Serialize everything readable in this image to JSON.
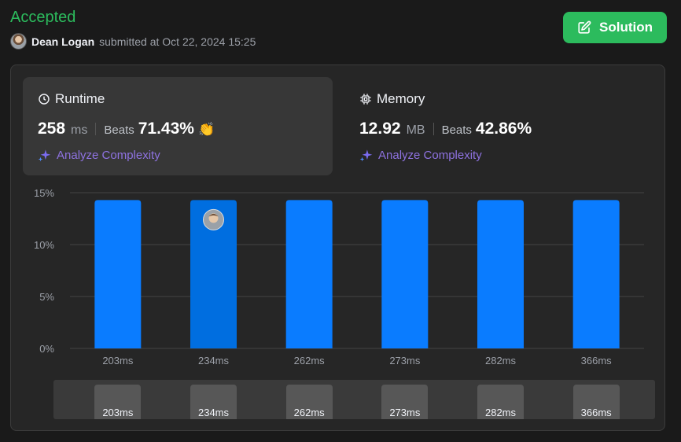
{
  "header": {
    "status": "Accepted",
    "user_name": "Dean Logan",
    "submitted_text": "submitted at Oct 22, 2024 15:25",
    "solution_label": "Solution"
  },
  "runtime": {
    "title": "Runtime",
    "value": "258",
    "unit": "ms",
    "beats_label": "Beats",
    "beats_value": "71.43%",
    "analyze_label": "Analyze Complexity"
  },
  "memory": {
    "title": "Memory",
    "value": "12.92",
    "unit": "MB",
    "beats_label": "Beats",
    "beats_value": "42.86%",
    "analyze_label": "Analyze Complexity"
  },
  "colors": {
    "accepted": "#2cbb5d",
    "bar": "#0a7cff",
    "bar_selected": "#006ee0",
    "analyze": "#8e72e0"
  },
  "chart_data": {
    "type": "bar",
    "categories": [
      "203ms",
      "234ms",
      "262ms",
      "273ms",
      "282ms",
      "366ms"
    ],
    "values": [
      14.29,
      14.29,
      14.29,
      14.29,
      14.29,
      14.29
    ],
    "selected_index": 1,
    "y_ticks": [
      "0%",
      "5%",
      "10%",
      "15%"
    ],
    "ylim": [
      0,
      15
    ],
    "grid": true
  },
  "range_strip": {
    "labels": [
      "203ms",
      "234ms",
      "262ms",
      "273ms",
      "282ms",
      "366ms"
    ]
  }
}
